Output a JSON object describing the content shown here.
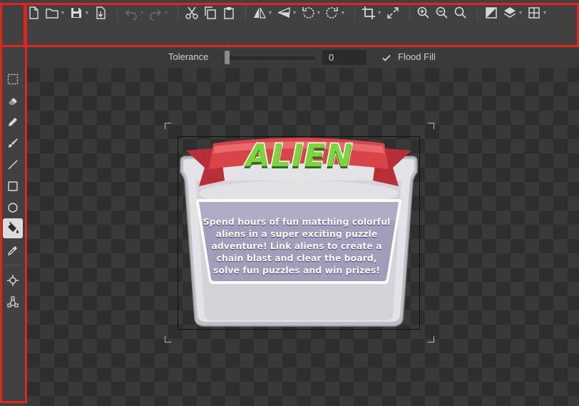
{
  "toolbar": {
    "row1": [
      {
        "icon": "new-file-icon",
        "caret": false,
        "enabled": true
      },
      {
        "icon": "open-folder-icon",
        "caret": true,
        "enabled": true
      },
      {
        "icon": "save-icon",
        "caret": true,
        "enabled": true
      },
      {
        "icon": "export-icon",
        "caret": false,
        "enabled": true
      },
      {
        "sep": true
      },
      {
        "icon": "undo-icon",
        "caret": true,
        "enabled": false
      },
      {
        "icon": "redo-icon",
        "caret": true,
        "enabled": false
      },
      {
        "sep": true
      },
      {
        "icon": "cut-icon",
        "caret": false,
        "enabled": true
      },
      {
        "icon": "copy-icon",
        "caret": false,
        "enabled": true
      },
      {
        "icon": "paste-icon",
        "caret": false,
        "enabled": true
      },
      {
        "sep": true
      },
      {
        "icon": "flip-horizontal-icon",
        "caret": true,
        "enabled": true
      },
      {
        "icon": "flip-vertical-icon",
        "caret": true,
        "enabled": true
      },
      {
        "icon": "rotate-left-icon",
        "caret": true,
        "enabled": true
      },
      {
        "icon": "rotate-right-icon",
        "caret": true,
        "enabled": true
      },
      {
        "sep": true
      },
      {
        "icon": "crop-icon",
        "caret": true,
        "enabled": true
      },
      {
        "icon": "resize-icon",
        "caret": false,
        "enabled": true
      },
      {
        "sep": true
      },
      {
        "icon": "zoom-in-icon",
        "caret": false,
        "enabled": true
      },
      {
        "icon": "zoom-out-icon",
        "caret": false,
        "enabled": true
      },
      {
        "icon": "zoom-fit-icon",
        "caret": false,
        "enabled": true
      },
      {
        "sep": true
      },
      {
        "icon": "adjust-icon",
        "caret": false,
        "enabled": true
      },
      {
        "icon": "layers-icon",
        "caret": true,
        "enabled": true
      },
      {
        "icon": "grid-icon",
        "caret": true,
        "enabled": true
      }
    ],
    "row2": [
      {
        "icon": "play-icon"
      }
    ]
  },
  "sidebar": {
    "tools": [
      {
        "icon": "document-icon",
        "active": false
      },
      {
        "icon": "play-circle-icon",
        "active": false
      },
      {
        "icon": "marquee-select-icon",
        "active": false
      },
      {
        "icon": "eraser-icon",
        "active": false
      },
      {
        "icon": "pencil-icon",
        "active": false
      },
      {
        "icon": "brush-icon",
        "active": false
      },
      {
        "icon": "line-icon",
        "active": false
      },
      {
        "icon": "rectangle-icon",
        "active": false
      },
      {
        "icon": "ellipse-icon",
        "active": false
      },
      {
        "icon": "paint-bucket-icon",
        "active": true
      },
      {
        "icon": "eyedropper-icon",
        "active": false
      },
      {
        "icon": "crosshair-icon",
        "active": false
      },
      {
        "icon": "path-nodes-icon",
        "active": false
      }
    ]
  },
  "options": {
    "tolerance_label": "Tolerance",
    "tolerance_value": "0",
    "tolerance_fraction": 0.0,
    "flood_fill_label": "Flood Fill",
    "flood_fill_checked": true
  },
  "canvas": {
    "title": "ALIEN",
    "body": "Spend hours of fun matching colorful aliens in a super exciting puzzle adventure! Link aliens to create a chain blast and clear the board, solve fun  puzzles and win prizes!"
  },
  "colors": {
    "highlight": "#e0261c",
    "banner": "#d9434a",
    "title_fill": "#7ad63a",
    "panel": "#d3d3d8",
    "text_box": "#a39dbb"
  }
}
